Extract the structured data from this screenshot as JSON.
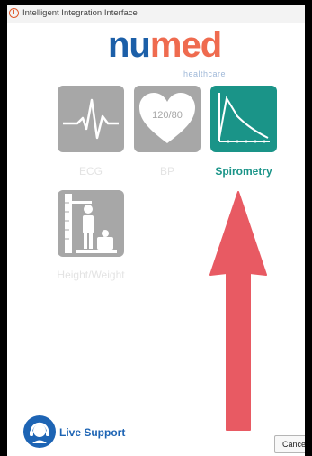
{
  "window": {
    "title": "Intelligent Integration Interface"
  },
  "logo": {
    "part1": "nu",
    "part2": "med",
    "subtitle": "healthcare"
  },
  "tiles": [
    {
      "label": "ECG",
      "icon": "ecg-icon",
      "active": false
    },
    {
      "label": "BP",
      "icon": "heart-bp-icon",
      "active": false,
      "icon_text": "120/80"
    },
    {
      "label": "Spirometry",
      "icon": "spirometry-chart-icon",
      "active": true
    },
    {
      "label": "Height/Weight",
      "icon": "height-weight-scale-icon",
      "active": false
    }
  ],
  "support": {
    "label": "Live Support",
    "icon": "headset-icon"
  },
  "buttons": {
    "cancel": "Cancel"
  },
  "annotation": {
    "arrow_color": "#e85a63"
  },
  "colors": {
    "active_tile": "#1a9488",
    "inactive_tile": "#a7a7a7",
    "brand_blue": "#1c5fa8",
    "brand_orange": "#ef6b4f"
  }
}
